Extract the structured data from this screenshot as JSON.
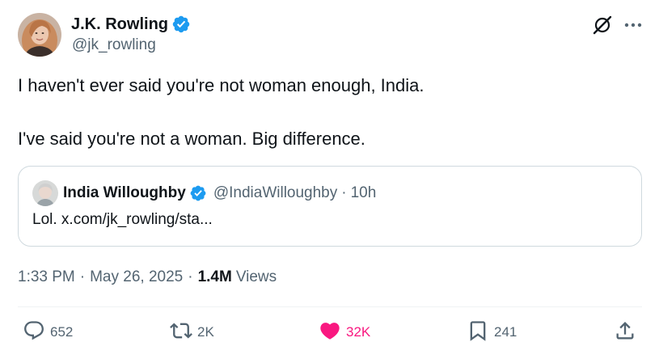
{
  "author": {
    "name": "J.K. Rowling",
    "handle": "@jk_rowling",
    "verified": true
  },
  "tweet": {
    "line1": "I haven't ever said you're not woman enough, India.",
    "line2": "I've said you're not a woman. Big difference."
  },
  "quote": {
    "name": "India Willoughby",
    "handle": "@IndiaWilloughby",
    "separator": "·",
    "time": "10h",
    "text": "Lol. x.com/jk_rowling/sta..."
  },
  "meta": {
    "time": "1:33 PM",
    "separator": "·",
    "date": "May 26, 2025",
    "views_count": "1.4M",
    "views_label": "Views"
  },
  "actions": {
    "replies": "652",
    "reposts": "2K",
    "likes": "32K",
    "bookmarks": "241"
  },
  "icons": [
    "grok-icon",
    "more-icon",
    "verified-badge-icon",
    "reply-icon",
    "repost-icon",
    "like-heart-icon",
    "bookmark-icon",
    "share-icon"
  ],
  "colors": {
    "verified": "#1d9bf0",
    "like": "#f91880",
    "secondary_text": "#536471",
    "primary_text": "#0f1419"
  }
}
